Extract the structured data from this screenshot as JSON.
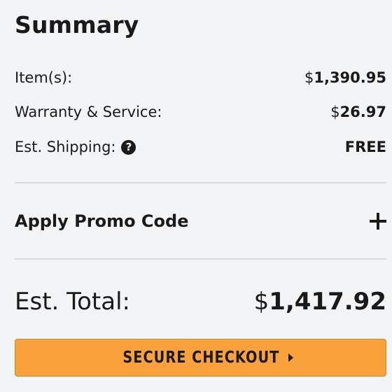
{
  "summary": {
    "title": "Summary",
    "rows": [
      {
        "label": "Item(s):",
        "currency": "$",
        "amount": "1,390.95"
      },
      {
        "label": "Warranty & Service:",
        "currency": "$",
        "amount": "26.97"
      },
      {
        "label": "Est. Shipping:",
        "value": "FREE",
        "help_icon": "question-circle-icon"
      }
    ],
    "promo": {
      "label": "Apply Promo Code",
      "icon": "plus-icon"
    },
    "total": {
      "label": "Est. Total:",
      "currency": "$",
      "amount": "1,417.92"
    },
    "checkout": {
      "label": "SECURE CHECKOUT",
      "icon": "caret-right-icon",
      "color": "#f9a13a"
    }
  }
}
